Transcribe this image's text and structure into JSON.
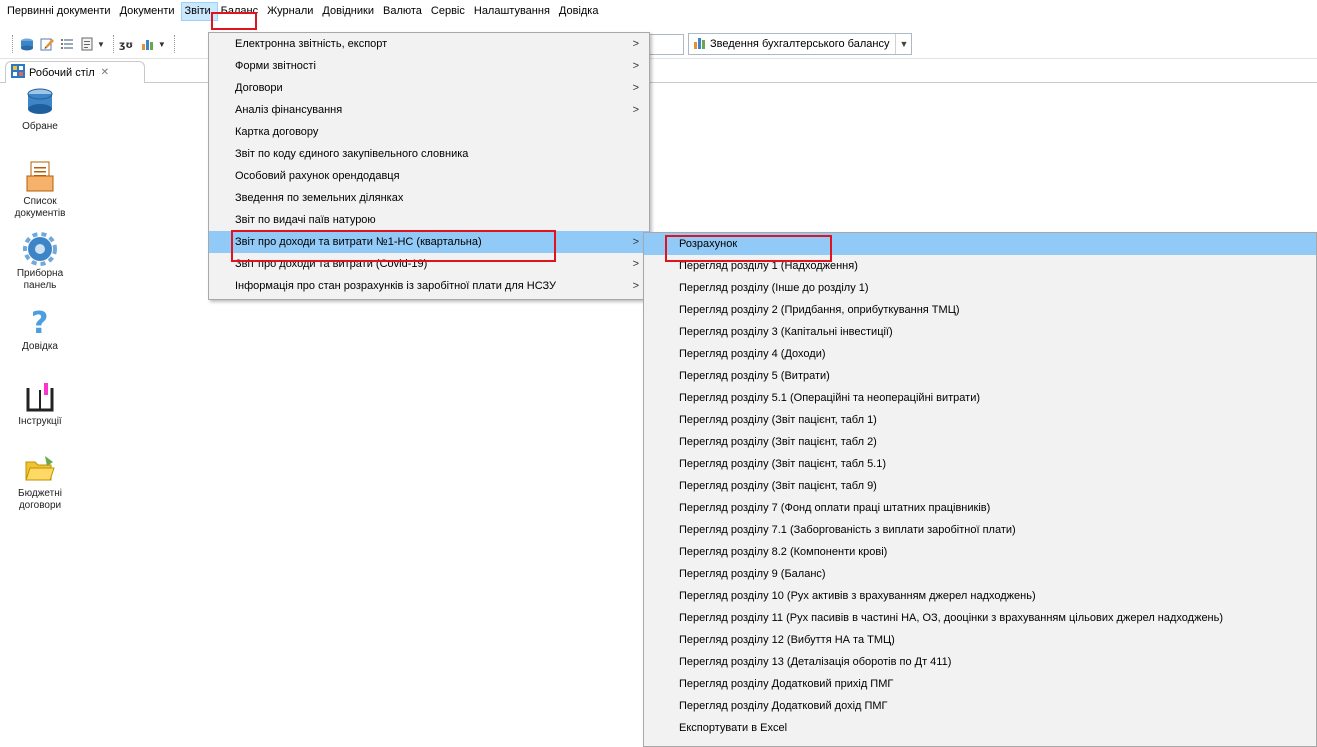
{
  "menubar": {
    "items": [
      "Первинні документи",
      "Документи",
      "Звіти",
      "Баланс",
      "Журнали",
      "Довідники",
      "Валюта",
      "Сервіс",
      "Налаштування",
      "Довідка"
    ],
    "active_index": 2
  },
  "toolbar": {
    "report_combo": "Зведення бухгалтерського балансу"
  },
  "tab": {
    "label": "Робочий стіл",
    "close": "✕"
  },
  "desktop": {
    "items": [
      {
        "label": "Обране",
        "icon": "favorites-icon"
      },
      {
        "label": "Список документів",
        "icon": "documents-list-icon"
      },
      {
        "label": "Приборна панель",
        "icon": "dashboard-gear-icon"
      },
      {
        "label": "Довідка",
        "icon": "help-question-icon"
      },
      {
        "label": "Інструкції",
        "icon": "instructions-book-icon"
      },
      {
        "label": "Бюджетні договори",
        "icon": "budget-contracts-folder-icon"
      }
    ]
  },
  "reports_menu": {
    "items": [
      {
        "label": "Електронна звітність, експорт",
        "submenu": true
      },
      {
        "label": "Форми звітності",
        "submenu": true
      },
      {
        "label": "Договори",
        "submenu": true
      },
      {
        "label": "Аналіз фінансування",
        "submenu": true
      },
      {
        "label": "Картка договору",
        "submenu": false
      },
      {
        "label": "Звіт по коду єдиного закупівельного словника",
        "submenu": false
      },
      {
        "label": "Особовий рахунок орендодавця",
        "submenu": false
      },
      {
        "label": "Зведення по земельних ділянках",
        "submenu": false
      },
      {
        "label": "Звіт по видачі паїв натурою",
        "submenu": false
      },
      {
        "label": "Звіт про доходи та витрати №1-НС (квартальна)",
        "submenu": true,
        "highlighted": true
      },
      {
        "label": "Звіт про доходи та витрати (Covid-19)",
        "submenu": true
      },
      {
        "label": "Інформація про стан розрахунків із заробітної плати для НСЗУ",
        "submenu": true
      }
    ]
  },
  "submenu": {
    "items": [
      {
        "label": "Розрахунок",
        "highlighted": true
      },
      {
        "label": "Перегляд розділу 1 (Надходження)"
      },
      {
        "label": "Перегляд розділу (Інше до розділу 1)"
      },
      {
        "label": "Перегляд розділу 2 (Придбання, оприбуткування ТМЦ)"
      },
      {
        "label": "Перегляд розділу 3 (Капітальні інвестиції)"
      },
      {
        "label": "Перегляд розділу 4 (Доходи)"
      },
      {
        "label": "Перегляд розділу 5 (Витрати)"
      },
      {
        "label": "Перегляд розділу 5.1 (Операційні та неопераційні витрати)"
      },
      {
        "label": "Перегляд розділу (Звіт пацієнт, табл 1)"
      },
      {
        "label": "Перегляд розділу (Звіт пацієнт, табл 2)"
      },
      {
        "label": "Перегляд розділу (Звіт пацієнт, табл 5.1)"
      },
      {
        "label": "Перегляд розділу (Звіт пацієнт, табл 9)"
      },
      {
        "label": "Перегляд розділу 7 (Фонд оплати праці штатних працівників)"
      },
      {
        "label": "Перегляд розділу 7.1 (Заборгованість з виплати заробітної плати)"
      },
      {
        "label": "Перегляд розділу 8.2 (Компоненти крові)"
      },
      {
        "label": "Перегляд розділу 9 (Баланс)"
      },
      {
        "label": "Перегляд розділу 10 (Рух активів з врахуванням джерел надходжень)"
      },
      {
        "label": "Перегляд розділу 11 (Рух пасивів в частині НА, ОЗ, дооцінки з врахуванням цільових джерел надходжень)"
      },
      {
        "label": "Перегляд розділу 12 (Вибуття НА та ТМЦ)"
      },
      {
        "label": "Перегляд розділу 13 (Деталізація оборотів по Дт 411)"
      },
      {
        "label": "Перегляд розділу Додатковий прихід ПМГ"
      },
      {
        "label": "Перегляд розділу Додатковий дохід ПМГ"
      },
      {
        "label": "Експортувати в Excel"
      }
    ]
  },
  "colors": {
    "highlight": "#91c9f7",
    "menu_bg": "#f2f2f2",
    "annotation": "#e0141e"
  }
}
